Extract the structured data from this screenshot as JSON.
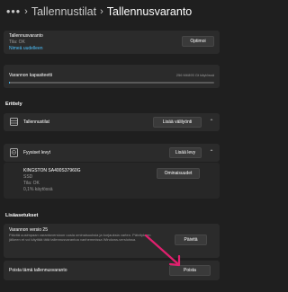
{
  "header": {
    "dots": "•••",
    "breadcrumb_1": "Tallennustilat",
    "breadcrumb_2": "Tallennusvaranto"
  },
  "pool_card": {
    "name": "Tallennusvaranto",
    "status": "Tila: OK",
    "rename_link": "Nimeä uudelleen",
    "optimize_button": "Optimoi"
  },
  "capacity": {
    "label": "Varannon kapasiteetti",
    "usage_text": "256 Mt/893 Gt käytössä",
    "used_fraction": 0.0003
  },
  "sections": {
    "details_title": "Erittely",
    "settings_title": "Lisäasetukset"
  },
  "spaces_row": {
    "label": "Tallennustilat",
    "button": "Lisää välilyönti"
  },
  "disks_row": {
    "label": "Fyysiset levyt",
    "button": "Lisää levy"
  },
  "disk_item": {
    "model": "KINGSTON SA400S37960G",
    "type": "SSD",
    "status": "Tila: OK",
    "usage": "0,1% käytössä",
    "properties_button": "Ominaisuudet"
  },
  "upgrade": {
    "title": "Varannon versio 25",
    "description": "Päivitä uusimpaan varantoversioon uusia ominaisuuksia ja korjauksia varten. Päivityksen jälkeen et voi käyttää tätä tallennusvarantoa vanhemmissa Windows-versioissa.",
    "button": "Päivitä"
  },
  "remove": {
    "label": "Poista tämä tallennusvaranto",
    "button": "Poista"
  },
  "colors": {
    "background": "#1f1f1f",
    "card": "#2b2b2b",
    "accent": "#4cc2ff",
    "annotation_arrow": "#e0206e"
  }
}
